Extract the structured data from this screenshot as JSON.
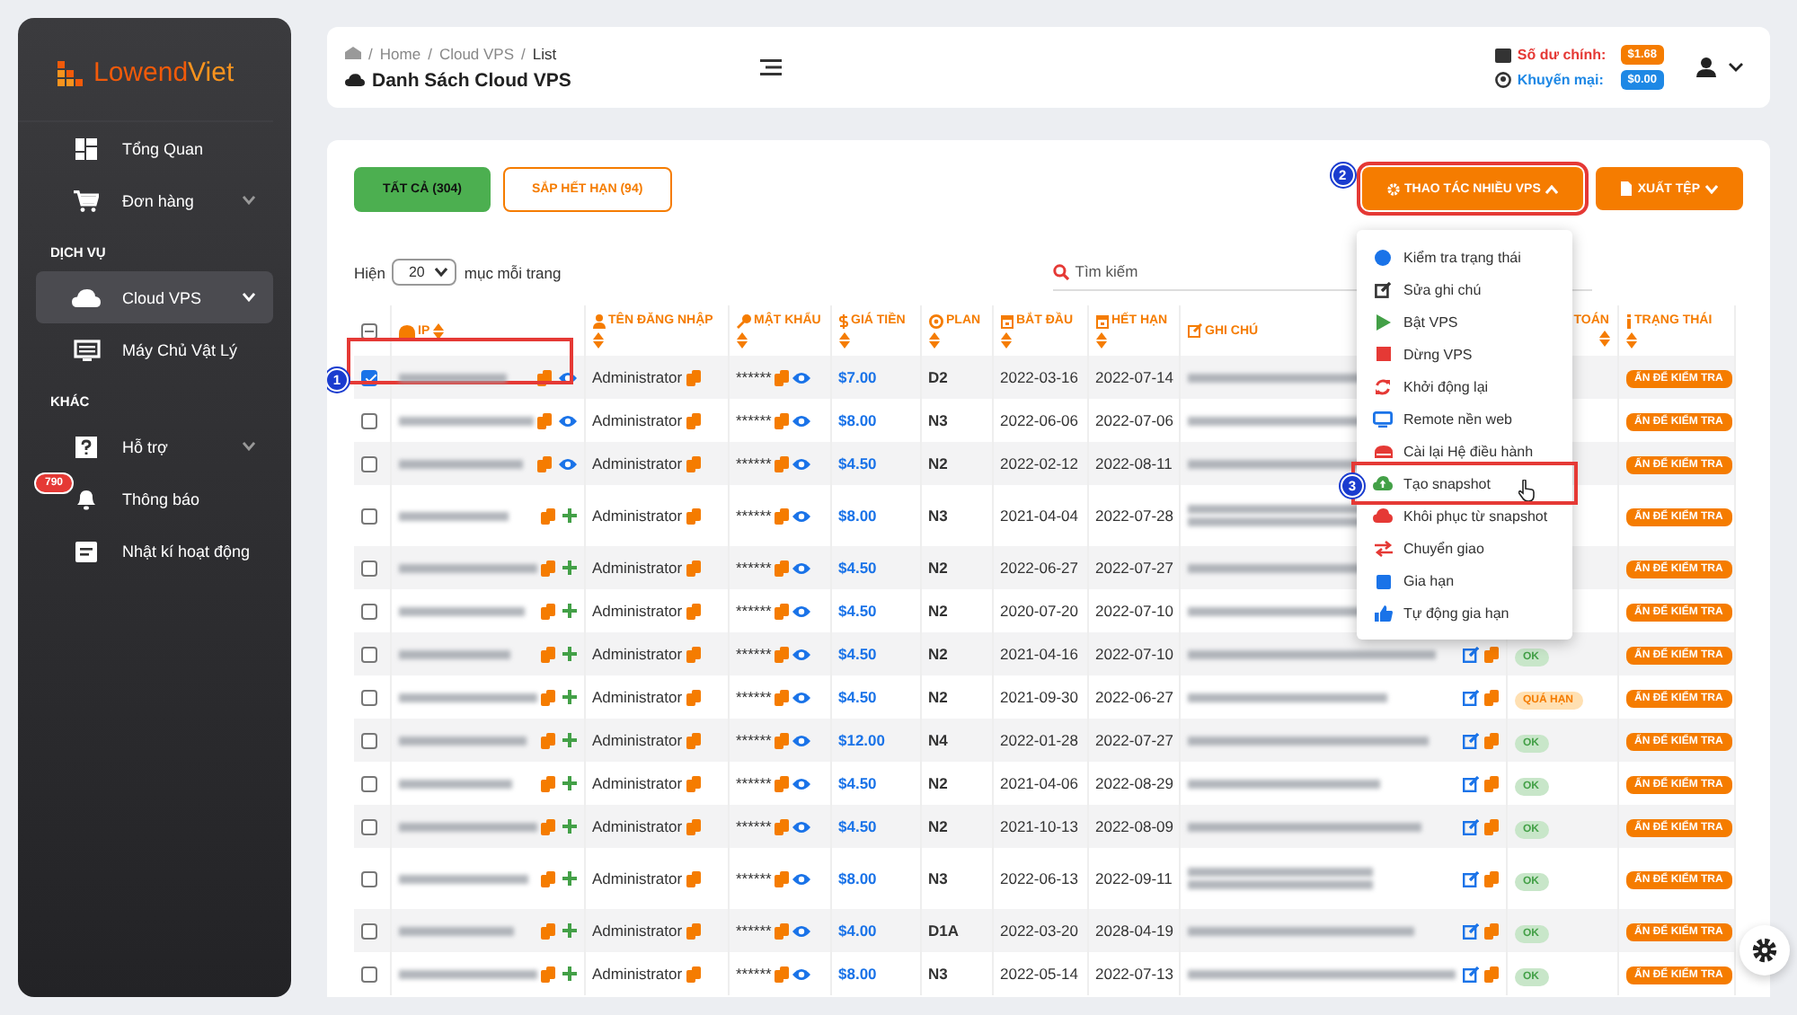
{
  "sidebar": {
    "logo": {
      "first": "Lowend",
      "second": "Viet"
    },
    "items": [
      {
        "kind": "item",
        "label": "Tổng Quan",
        "selected": false,
        "has_submenu": false
      },
      {
        "kind": "item",
        "label": "Đơn hàng",
        "selected": false,
        "has_submenu": true
      },
      {
        "kind": "section",
        "label": "DỊCH VỤ"
      },
      {
        "kind": "item",
        "label": "Cloud VPS",
        "selected": true,
        "has_submenu": true
      },
      {
        "kind": "item",
        "label": "Máy Chủ Vật Lý",
        "selected": false,
        "has_submenu": false
      },
      {
        "kind": "section",
        "label": "KHÁC"
      },
      {
        "kind": "item",
        "label": "Hỗ trợ",
        "selected": false,
        "has_submenu": true
      },
      {
        "kind": "item",
        "label": "Thông báo",
        "selected": false,
        "has_submenu": false,
        "badge": "790"
      },
      {
        "kind": "item",
        "label": "Nhật kí hoạt động",
        "selected": false,
        "has_submenu": false
      }
    ]
  },
  "header": {
    "breadcrumb": [
      {
        "separator": "/",
        "label": "Home"
      },
      {
        "separator": "/",
        "label": "Cloud VPS"
      },
      {
        "separator": "/",
        "label": "List"
      }
    ],
    "title": "Danh Sách Cloud VPS",
    "balance": {
      "label": "Số dư chính:",
      "value": "$1.68"
    },
    "promo": {
      "label": "Khuyến mại:",
      "value": "$0.00"
    }
  },
  "list": {
    "tabs": [
      {
        "label": "TẤT CẢ (304)",
        "selected": true
      },
      {
        "label": "SẮP HẾT HẠN (94)",
        "selected": false
      }
    ],
    "actions": [
      {
        "label": "THAO TÁC NHIỀU VPS",
        "expanded": true,
        "callout": "2"
      },
      {
        "label": "XUẤT TỆP",
        "expanded": false
      }
    ],
    "page_size": {
      "before": "Hiện",
      "value": "20",
      "after": "mục mỗi trang"
    },
    "search": {
      "placeholder": "Tìm kiếm"
    },
    "select_all": {
      "indeterminate": true
    },
    "columns": [
      {
        "label": "IP",
        "sortable": true
      },
      {
        "label": "TÊN ĐĂNG NHẬP",
        "sortable": true
      },
      {
        "label": "MẬT KHẨU",
        "sortable": true
      },
      {
        "label": "GIÁ TIỀN",
        "sortable": true
      },
      {
        "label": "PLAN",
        "sortable": true
      },
      {
        "label": "BẮT ĐẦU",
        "sortable": true
      },
      {
        "label": "HẾT HẠN",
        "sortable": true
      },
      {
        "label": "GHI CHÚ",
        "sortable": false
      },
      {
        "label": "TOÁN",
        "sortable": true
      },
      {
        "label": "TRẠNG THÁI",
        "sortable": true
      }
    ],
    "rows": [
      {
        "kind": "view",
        "checked": true,
        "callout": "1",
        "username": "Administrator",
        "password": "******",
        "price": "$7.00",
        "plan": "D2",
        "start": "2022-03-16",
        "end": "2022-07-14",
        "note_wrapped": false,
        "note_tools": false,
        "status": "ẤN ĐỂ KIỂM TRA"
      },
      {
        "kind": "view",
        "checked": false,
        "username": "Administrator",
        "password": "******",
        "price": "$8.00",
        "plan": "N3",
        "start": "2022-06-06",
        "end": "2022-07-06",
        "note_wrapped": false,
        "note_tools": false,
        "status": "ẤN ĐỂ KIỂM TRA"
      },
      {
        "kind": "view",
        "checked": false,
        "username": "Administrator",
        "password": "******",
        "price": "$4.50",
        "plan": "N2",
        "start": "2022-02-12",
        "end": "2022-08-11",
        "note_wrapped": false,
        "note_tools": false,
        "status": "ẤN ĐỂ KIỂM TRA"
      },
      {
        "kind": "add",
        "checked": false,
        "username": "Administrator",
        "password": "******",
        "price": "$8.00",
        "plan": "N3",
        "start": "2021-04-04",
        "end": "2022-07-28",
        "note_wrapped": true,
        "note_tools": false,
        "status": "ẤN ĐỂ KIỂM TRA"
      },
      {
        "kind": "add",
        "checked": false,
        "username": "Administrator",
        "password": "******",
        "price": "$4.50",
        "plan": "N2",
        "start": "2022-06-27",
        "end": "2022-07-27",
        "note_wrapped": false,
        "note_tools": false,
        "status": "ẤN ĐỂ KIỂM TRA"
      },
      {
        "kind": "add",
        "checked": false,
        "username": "Administrator",
        "password": "******",
        "price": "$4.50",
        "plan": "N2",
        "start": "2020-07-20",
        "end": "2022-07-10",
        "note_wrapped": false,
        "note_tools": false,
        "status": "ẤN ĐỂ KIỂM TRA"
      },
      {
        "kind": "add",
        "checked": false,
        "username": "Administrator",
        "password": "******",
        "price": "$4.50",
        "plan": "N2",
        "start": "2021-04-16",
        "end": "2022-07-10",
        "note_wrapped": false,
        "note_tools": true,
        "payment": {
          "kind": "ok",
          "label": "OK"
        },
        "status": "ẤN ĐỂ KIỂM TRA"
      },
      {
        "kind": "add",
        "checked": false,
        "username": "Administrator",
        "password": "******",
        "price": "$4.50",
        "plan": "N2",
        "start": "2021-09-30",
        "end": "2022-06-27",
        "note_wrapped": false,
        "note_tools": true,
        "payment": {
          "kind": "overdue",
          "label": "QUÁ HẠN"
        },
        "status": "ẤN ĐỂ KIỂM TRA"
      },
      {
        "kind": "add",
        "checked": false,
        "username": "Administrator",
        "password": "******",
        "price": "$12.00",
        "plan": "N4",
        "start": "2022-01-28",
        "end": "2022-07-27",
        "note_wrapped": false,
        "note_tools": true,
        "payment": {
          "kind": "ok",
          "label": "OK"
        },
        "status": "ẤN ĐỂ KIỂM TRA"
      },
      {
        "kind": "add",
        "checked": false,
        "username": "Administrator",
        "password": "******",
        "price": "$4.50",
        "plan": "N2",
        "start": "2021-04-06",
        "end": "2022-08-29",
        "note_wrapped": false,
        "note_tools": true,
        "payment": {
          "kind": "ok",
          "label": "OK"
        },
        "status": "ẤN ĐỂ KIỂM TRA"
      },
      {
        "kind": "add",
        "checked": false,
        "username": "Administrator",
        "password": "******",
        "price": "$4.50",
        "plan": "N2",
        "start": "2021-10-13",
        "end": "2022-08-09",
        "note_wrapped": false,
        "note_tools": true,
        "payment": {
          "kind": "ok",
          "label": "OK"
        },
        "status": "ẤN ĐỂ KIỂM TRA"
      },
      {
        "kind": "add",
        "checked": false,
        "username": "Administrator",
        "password": "******",
        "price": "$8.00",
        "plan": "N3",
        "start": "2022-06-13",
        "end": "2022-09-11",
        "note_wrapped": true,
        "note_tools": true,
        "payment": {
          "kind": "ok",
          "label": "OK"
        },
        "status": "ẤN ĐỂ KIỂM TRA"
      },
      {
        "kind": "add",
        "checked": false,
        "username": "Administrator",
        "password": "******",
        "price": "$4.00",
        "plan": "D1A",
        "start": "2022-03-20",
        "end": "2028-04-19",
        "note_wrapped": false,
        "note_tools": true,
        "payment": {
          "kind": "ok",
          "label": "OK"
        },
        "status": "ẤN ĐỂ KIỂM TRA"
      },
      {
        "kind": "add",
        "checked": false,
        "username": "Administrator",
        "password": "******",
        "price": "$8.00",
        "plan": "N3",
        "start": "2022-05-14",
        "end": "2022-07-13",
        "note_wrapped": false,
        "note_tools": true,
        "payment": {
          "kind": "ok",
          "label": "OK"
        },
        "status": "ẤN ĐỂ KIỂM TRA"
      }
    ],
    "menu": {
      "items": [
        {
          "label": "Kiểm tra trạng thái"
        },
        {
          "label": "Sửa ghi chú"
        },
        {
          "label": "Bật VPS"
        },
        {
          "label": "Dừng VPS"
        },
        {
          "label": "Khởi động lại"
        },
        {
          "label": "Remote nền web"
        },
        {
          "label": "Cài lại Hệ điều hành"
        },
        {
          "label": "Tạo snapshot",
          "callout": "3"
        },
        {
          "label": "Khôi phục từ snapshot"
        },
        {
          "label": "Chuyển giao"
        },
        {
          "label": "Gia hạn"
        },
        {
          "label": "Tự động gia hạn"
        }
      ]
    }
  }
}
